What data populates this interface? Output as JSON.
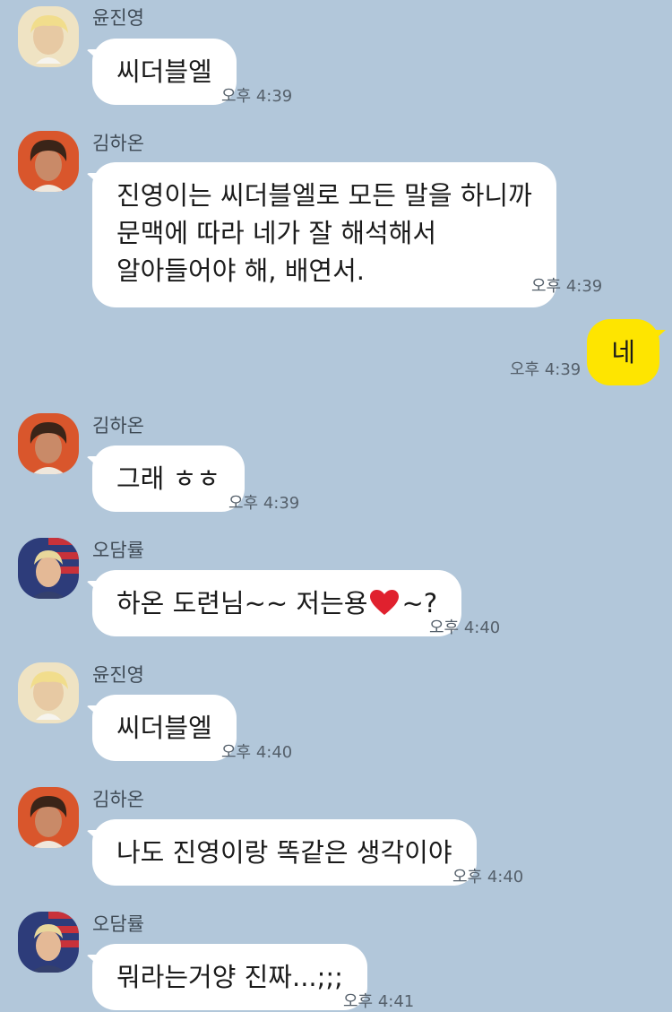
{
  "colors": {
    "background": "#b2c7da",
    "bubble_other": "#ffffff",
    "bubble_me": "#fee500",
    "heart": "#e0212e"
  },
  "messages": [
    {
      "sender": "윤진영",
      "text": "씨더블엘",
      "time": "오후 4:39"
    },
    {
      "sender": "김하온",
      "lines": [
        "진영이는 씨더블엘로 모든 말을 하니까",
        "문맥에 따라 네가 잘 해석해서",
        "알아들어야 해, 배연서."
      ],
      "time": "오후 4:39"
    },
    {
      "text": "네",
      "time": "오후 4:39"
    },
    {
      "sender": "김하온",
      "text": "그래 ㅎㅎ",
      "time": "오후 4:39"
    },
    {
      "sender": "오담률",
      "text_before": "하온 도련님~~ 저는용",
      "emoji": "heart-emoji",
      "text_after": "~?",
      "time": "오후 4:40"
    },
    {
      "sender": "윤진영",
      "text": "씨더블엘",
      "time": "오후 4:40"
    },
    {
      "sender": "김하온",
      "text": "나도 진영이랑 똑같은 생각이야",
      "time": "오후 4:40"
    },
    {
      "sender": "오담률",
      "text": "뭐라는거양 진짜...;;;",
      "time": "오후 4:41"
    }
  ]
}
